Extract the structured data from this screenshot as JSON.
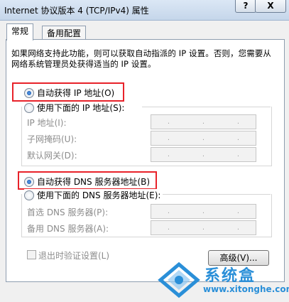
{
  "window": {
    "title": "Internet 协议版本 4 (TCP/IPv4) 属性",
    "help_button": "?",
    "close_button": "X"
  },
  "tabs": [
    {
      "label": "常规",
      "active": true
    },
    {
      "label": "备用配置",
      "active": false
    }
  ],
  "description": "如果网络支持此功能，则可以获取自动指派的 IP 设置。否则，您需要从网络系统管理员处获得适当的 IP 设置。",
  "ip": {
    "auto_label": "自动获得 IP 地址(O)",
    "manual_label": "使用下面的 IP 地址(S):",
    "selected": "auto",
    "fields": [
      {
        "label": "IP 地址(I):"
      },
      {
        "label": "子网掩码(U):"
      },
      {
        "label": "默认网关(D):"
      }
    ]
  },
  "dns": {
    "auto_label": "自动获得 DNS 服务器地址(B)",
    "manual_label": "使用下面的 DNS 服务器地址(E):",
    "selected": "auto",
    "fields": [
      {
        "label": "首选 DNS 服务器(P):"
      },
      {
        "label": "备用 DNS 服务器(A):"
      }
    ]
  },
  "validate_on_exit": {
    "label": "退出时验证设置(L)",
    "checked": false
  },
  "advanced_button": "高级(V)...",
  "watermark": {
    "name": "系统盒",
    "url": "www.xitonghe.com"
  },
  "colors": {
    "highlight": "#e8222a",
    "watermark": "#2a8fd8"
  }
}
